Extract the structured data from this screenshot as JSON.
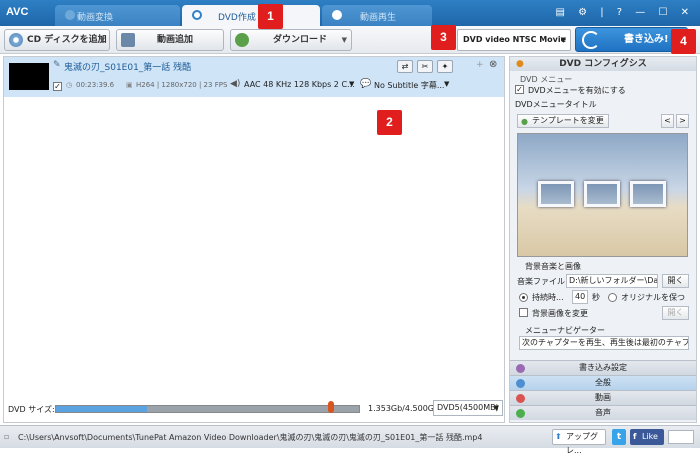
{
  "app": {
    "logo": "AVC"
  },
  "tabs": [
    {
      "label": "動画変換"
    },
    {
      "label": "DVD作成"
    },
    {
      "label": "動画再生"
    }
  ],
  "window_controls": "▤ ⚙ | ? — ☐ ✕",
  "badges": [
    "1",
    "2",
    "3",
    "4"
  ],
  "toolbar": {
    "add_cd": "CD ディスクを追加",
    "add_video": "動画追加",
    "download": "ダウンロード",
    "output_profile": "DVD video NTSC Movie",
    "burn": "書き込み!"
  },
  "file": {
    "name": "鬼滅の刃_S01E01_第一話 残酷",
    "duration": "00:23:39.6",
    "codec": "H264 | 1280x720 | 23 FPS",
    "audio": "AAC 48 KHz 128 Kbps 2 C...",
    "subtitle": "No Subtitle 字幕..."
  },
  "bottom": {
    "size_label": "DVD サイズ:",
    "size_value": "1.353Gb/4.500Gb",
    "disc_type": "DVD5(4500MB)",
    "usage_fraction": 0.3
  },
  "panel": {
    "title": "DVD コンフィグシス",
    "menu_group": "DVD メニュー",
    "enable_menu": "DVDメニューを有効にする",
    "menu_title_label": "DVDメニュータイトル",
    "change_template": "テンプレートを変更",
    "prev": "<",
    "next": ">",
    "bgm_group": "背景音楽と画像",
    "music_label": "音楽ファイル",
    "music_value": "D:\\新しいフォルダー\\Data",
    "open": "開く",
    "duration_label": "持続時...",
    "duration_value": "40",
    "seconds": "秒",
    "keep_original": "オリジナルを保つ",
    "change_bg_image": "背景画像を変更",
    "open_disabled": "開く",
    "navigator_group": "メニューナビゲーター",
    "navigator_value": "次のチャプターを再生、再生後は最初のチャプタ",
    "sections": [
      "書き込み設定",
      "全般",
      "動画",
      "音声"
    ]
  },
  "status": {
    "path": "C:\\Users\\Anvsoft\\Documents\\TunePat Amazon Video Downloader\\鬼滅の刃\\鬼滅の刃\\鬼滅の刃_S01E01_第一話 残酷.mp4",
    "upgrade": "アップグレ...",
    "twitter": "t",
    "facebook": "Like"
  },
  "colors": {
    "accent": "#1f72c2",
    "badge": "#e01e1e",
    "selection": "#cfe4f7"
  }
}
